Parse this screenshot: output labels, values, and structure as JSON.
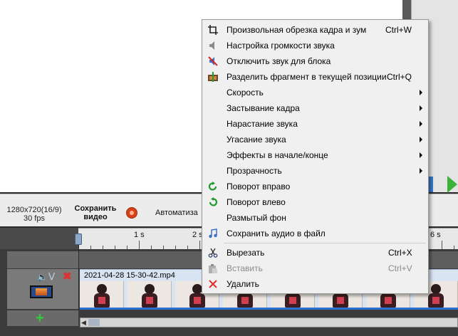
{
  "toolbar": {
    "resolution_line1": "1280x720(16/9)",
    "resolution_line2": "30 fps",
    "save_line1": "Сохранить",
    "save_line2": "видео",
    "automation_label": "Автоматиза"
  },
  "ruler": {
    "labels": [
      "1 s",
      "2 s",
      "6 s"
    ]
  },
  "timeline": {
    "clip_name": "2021-04-28 15-30-42.mp4"
  },
  "context_menu": {
    "items": [
      {
        "label": "Произвольная обрезка кадра и зум",
        "shortcut": "Ctrl+W",
        "icon": "crop-icon"
      },
      {
        "label": "Настройка громкости звука",
        "shortcut": "",
        "icon": "volume-icon"
      },
      {
        "label": "Отключить звук для блока",
        "shortcut": "",
        "icon": "mute-icon"
      },
      {
        "label": "Разделить фрагмент в текущей позиции",
        "shortcut": "Ctrl+Q",
        "icon": "split-icon"
      },
      {
        "label": "Скорость",
        "shortcut": "",
        "submenu": true
      },
      {
        "label": "Застывание кадра",
        "shortcut": "",
        "submenu": true
      },
      {
        "label": "Нарастание звука",
        "shortcut": "",
        "submenu": true
      },
      {
        "label": "Угасание звука",
        "shortcut": "",
        "submenu": true
      },
      {
        "label": "Эффекты в начале/конце",
        "shortcut": "",
        "submenu": true
      },
      {
        "label": "Прозрачность",
        "shortcut": "",
        "submenu": true
      },
      {
        "label": "Поворот вправо",
        "shortcut": "",
        "icon": "rotate-right-icon"
      },
      {
        "label": "Поворот влево",
        "shortcut": "",
        "icon": "rotate-left-icon"
      },
      {
        "label": "Размытый фон",
        "shortcut": ""
      },
      {
        "label": "Сохранить аудио в файл",
        "shortcut": "",
        "icon": "save-audio-icon"
      },
      {
        "label": "Вырезать",
        "shortcut": "Ctrl+X",
        "icon": "scissors-icon"
      },
      {
        "label": "Вставить",
        "shortcut": "Ctrl+V",
        "icon": "paste-icon",
        "disabled": true
      },
      {
        "label": "Удалить",
        "shortcut": "",
        "icon": "delete-icon"
      }
    ]
  },
  "colors": {
    "accent_blue": "#2f6fd0",
    "play_green": "#3bb33b",
    "delete_red": "#e03030",
    "add_green": "#2fcc3a"
  }
}
